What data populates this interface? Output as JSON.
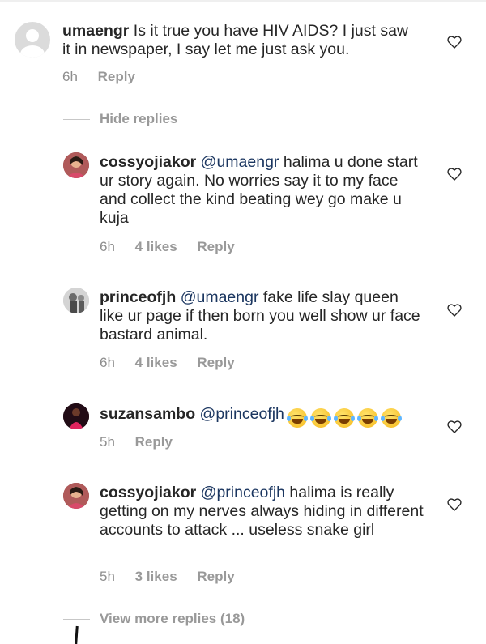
{
  "comments": [
    {
      "username": "umaengr",
      "text": " Is it true you have HIV AIDS? I just saw it in newspaper, I say let me just ask you.",
      "time": "6h",
      "likes": "",
      "reply": "Reply"
    }
  ],
  "hide_replies": "Hide replies",
  "replies": [
    {
      "username": "cossyojiakor",
      "mention": "@umaengr",
      "text": " halima u done start ur story again. No worries say it to my face and collect the kind beating wey go make u kuja",
      "time": "6h",
      "likes": "4 likes",
      "reply": "Reply"
    },
    {
      "username": "princeofjh",
      "mention": "@umaengr",
      "text": " fake life slay queen like ur page if then born you well show ur face bastard animal.",
      "time": "6h",
      "likes": "4 likes",
      "reply": "Reply"
    },
    {
      "username": "suzansambo",
      "mention": "@princeofjh",
      "text": "",
      "emoji": "face-with-tears-of-joy",
      "emoji_count": 5,
      "time": "5h",
      "likes": "",
      "reply": "Reply"
    },
    {
      "username": "cossyojiakor",
      "mention": "@princeofjh",
      "text": " halima is really getting on my nerves always hiding in different accounts to attack ... useless snake girl",
      "time": "5h",
      "likes": "3 likes",
      "reply": "Reply"
    }
  ],
  "view_more_replies": "View more replies (18)",
  "colors": {
    "text": "#262626",
    "meta": "#8e8e8e",
    "mention": "#1b3660",
    "divider": "#c7c7c7"
  }
}
